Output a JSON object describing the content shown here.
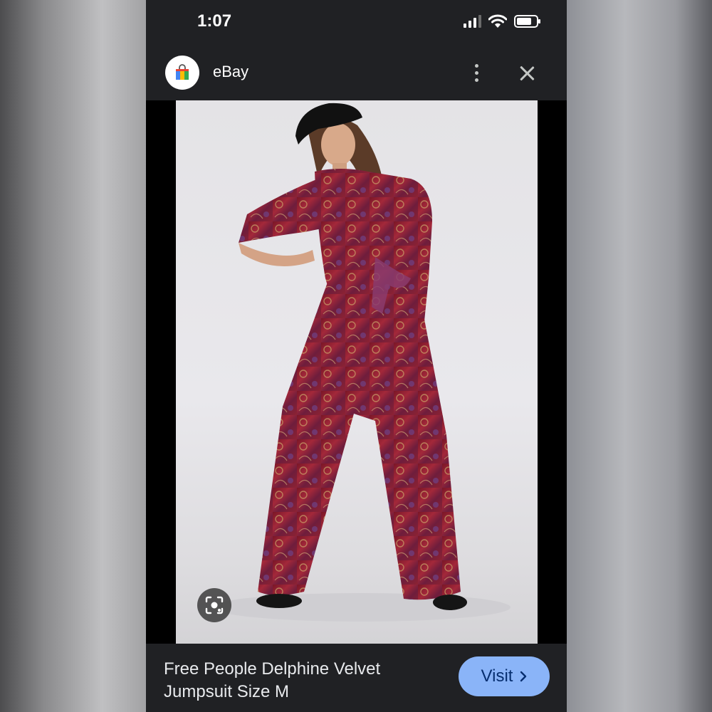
{
  "status_bar": {
    "time": "1:07"
  },
  "header": {
    "site_name": "eBay"
  },
  "image": {
    "alt": "Free People Delphine Velvet Jumpsuit Size M"
  },
  "caption": {
    "title": "Free People Delphine Velvet Jumpsuit Size M",
    "visit_label": "Visit"
  },
  "colors": {
    "accent": "#8ab4f8",
    "background": "#202124",
    "garment": "#8a1f2b"
  },
  "icons": [
    "signal-icon",
    "wifi-icon",
    "battery-icon",
    "shopping-bag-icon",
    "more-vert-icon",
    "close-icon",
    "lens-icon",
    "chevron-right-icon"
  ]
}
